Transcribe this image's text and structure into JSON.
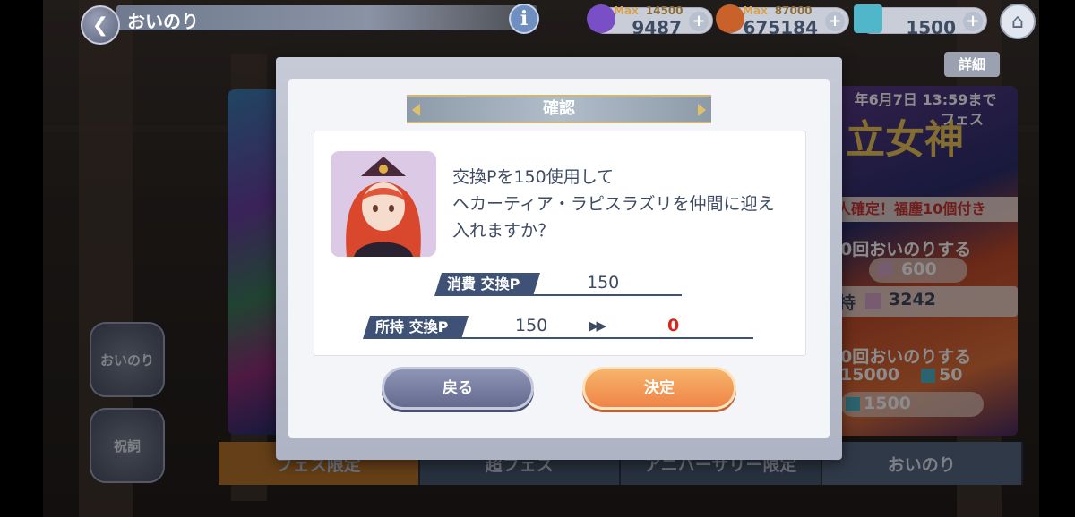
{
  "header": {
    "title": "おいのり",
    "info_icon": "info-icon",
    "home_icon": "home-icon"
  },
  "resources": [
    {
      "max_label": "Max",
      "max_value": "14500",
      "value": "9487",
      "icon": "stamina-icon",
      "color": "#7a4fc5"
    },
    {
      "max_label": "Max",
      "max_value": "87000",
      "value": "675184",
      "icon": "coin-bag-icon",
      "color": "#c9622a"
    },
    {
      "value": "1500",
      "icon": "gem-cube-icon",
      "color": "#4fb7c9"
    }
  ],
  "detail_button": "詳細",
  "banner_right": {
    "date": "年6月7日 13:59まで",
    "logo": "立女神",
    "logo_sub": "フェス",
    "tag": "人確定！福塵10個付き",
    "cta1": "0回おいのりする",
    "cost1": "600",
    "owned_prefix": "持",
    "owned": "3242",
    "cta2": "0回おいのりする",
    "cost2a": "15000",
    "cost2b": "50",
    "cost3": "1500"
  },
  "side_buttons": {
    "pray": "おいのり",
    "norito": "祝詞"
  },
  "tabs": [
    "フェス限定",
    "超フェス",
    "アニバーサリー限定",
    "おいのり"
  ],
  "dialog": {
    "title": "確認",
    "message_line1": "交換Pを150使用して",
    "message_line2": "ヘカーティア・ラピスラズリを仲間に迎え",
    "message_line3": "入れますか？",
    "cost_label": "消費 交換P",
    "cost_value": "150",
    "owned_label": "所持 交換P",
    "owned_before": "150",
    "arrow": "▶▶",
    "owned_after": "0",
    "back_button": "戻る",
    "confirm_button": "決定"
  },
  "colors": {
    "accent": "#3f5275",
    "confirm": "#ee8448",
    "back": "#646b8f",
    "danger": "#d7261c"
  }
}
